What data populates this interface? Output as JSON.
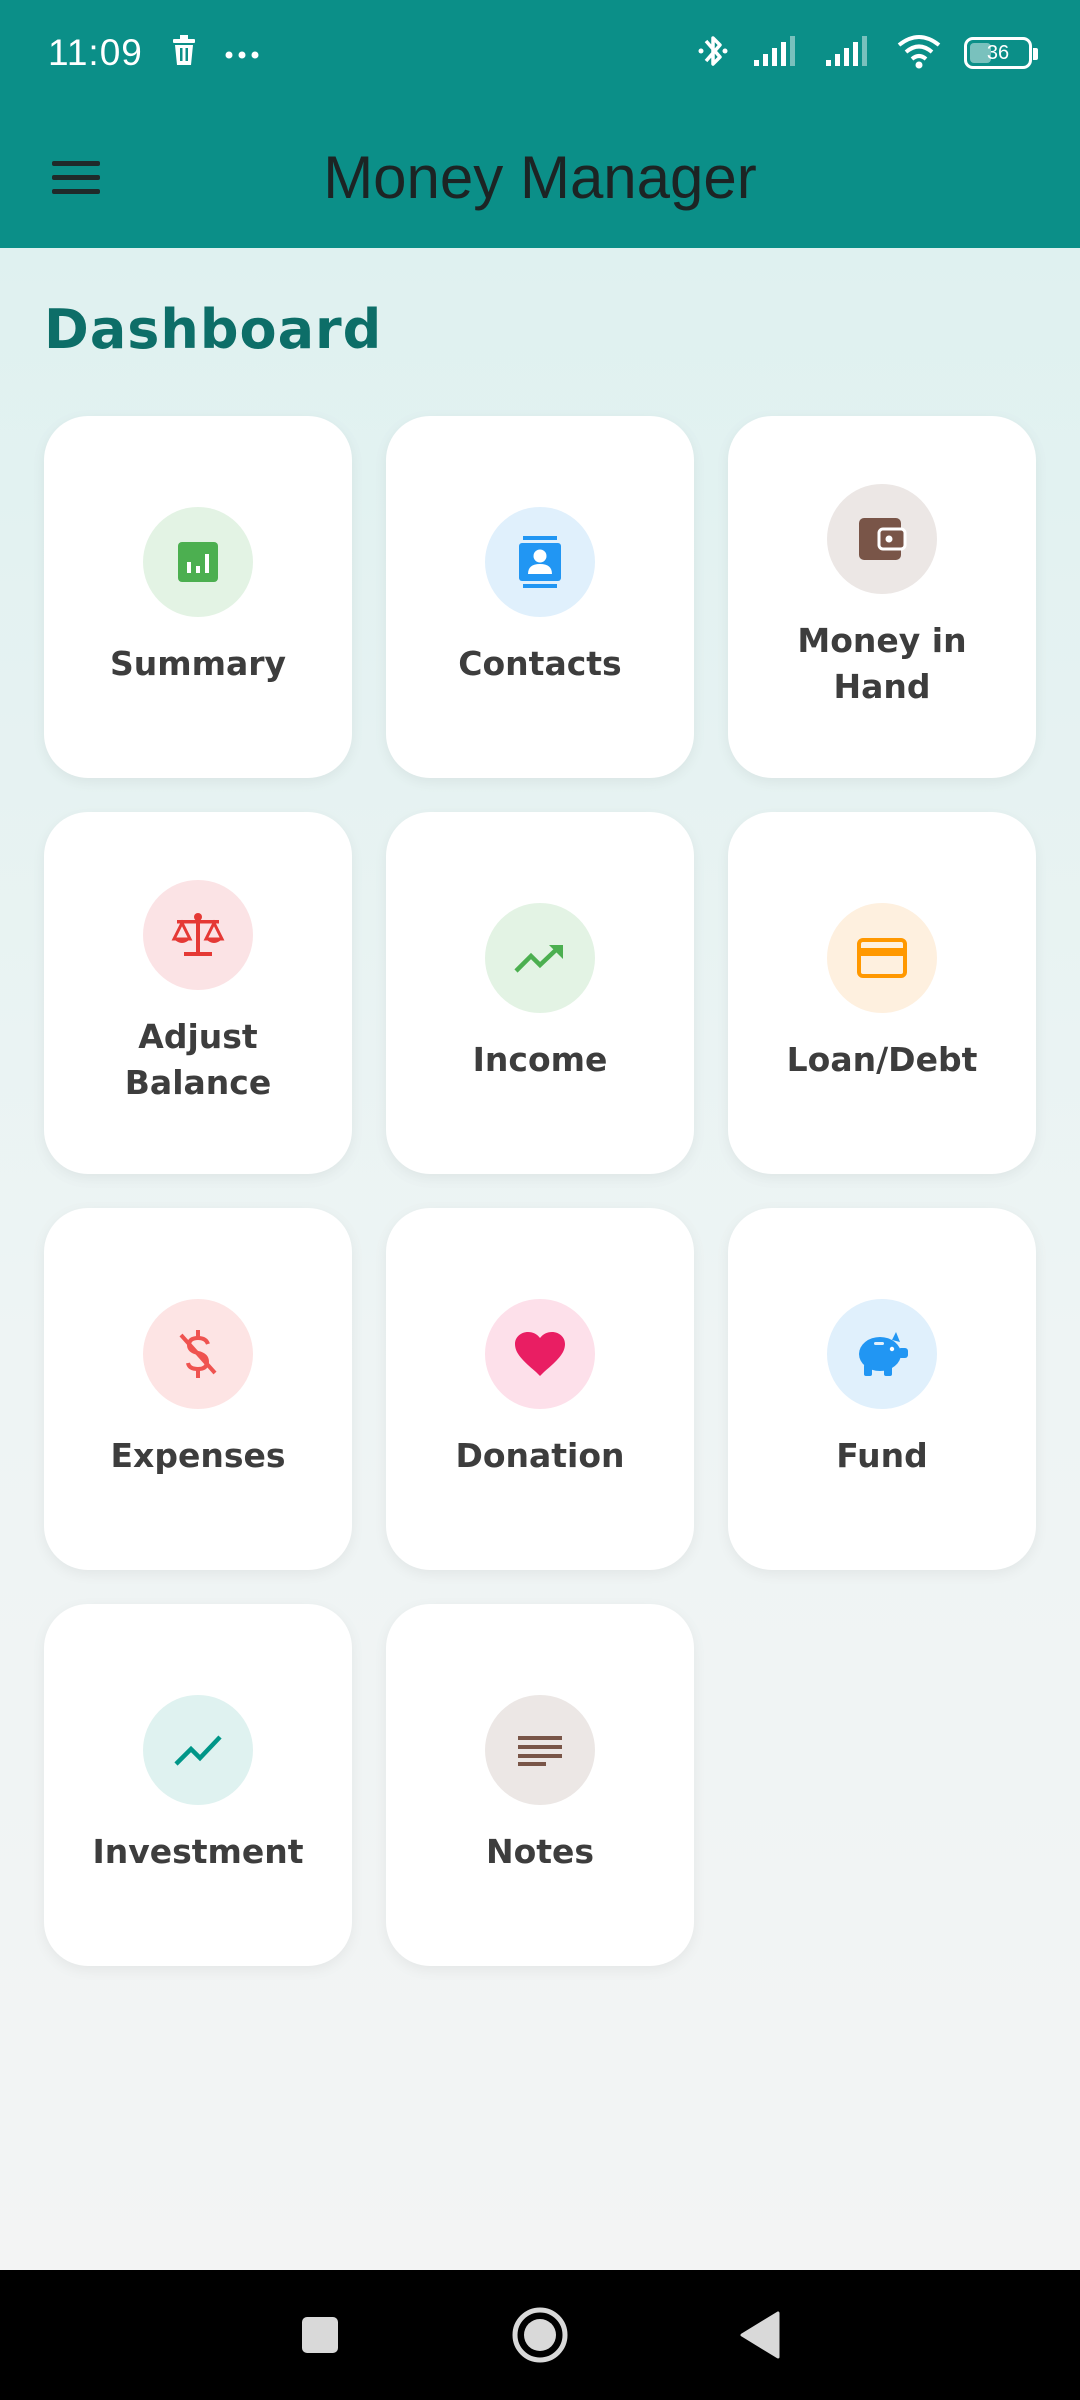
{
  "status_bar": {
    "time": "11:09",
    "battery_level": "36",
    "icons": [
      "delete-icon",
      "more-dots-icon",
      "bluetooth-icon",
      "signal-icon",
      "signal-icon",
      "wifi-icon",
      "battery-icon"
    ]
  },
  "app_bar": {
    "title": "Money Manager",
    "menu_icon": "hamburger-menu-icon"
  },
  "dashboard": {
    "title": "Dashboard",
    "tiles": [
      {
        "label": "Summary",
        "icon": "summary-chart-icon",
        "icon_color": "#4caf50",
        "bg_color": "#e3f3e4"
      },
      {
        "label": "Contacts",
        "icon": "contacts-icon",
        "icon_color": "#2196f3",
        "bg_color": "#e0f0fc"
      },
      {
        "label": "Money in\nHand",
        "icon": "wallet-icon",
        "icon_color": "#795548",
        "bg_color": "#ece7e5"
      },
      {
        "label": "Adjust\nBalance",
        "icon": "balance-scale-icon",
        "icon_color": "#e53935",
        "bg_color": "#fbe3e5"
      },
      {
        "label": "Income",
        "icon": "trending-up-icon",
        "icon_color": "#4caf50",
        "bg_color": "#e3f3e4"
      },
      {
        "label": "Loan/Debt",
        "icon": "credit-card-icon",
        "icon_color": "#ff9800",
        "bg_color": "#fef0df"
      },
      {
        "label": "Expenses",
        "icon": "money-off-icon",
        "icon_color": "#ef5350",
        "bg_color": "#fde4e4"
      },
      {
        "label": "Donation",
        "icon": "heart-icon",
        "icon_color": "#e91e63",
        "bg_color": "#fde0ea"
      },
      {
        "label": "Fund",
        "icon": "piggy-bank-icon",
        "icon_color": "#2196f3",
        "bg_color": "#e0f0fc"
      },
      {
        "label": "Investment",
        "icon": "investment-line-icon",
        "icon_color": "#009688",
        "bg_color": "#dff2f0"
      },
      {
        "label": "Notes",
        "icon": "notes-icon",
        "icon_color": "#795548",
        "bg_color": "#ece7e5"
      }
    ]
  },
  "nav_bar": {
    "icons": [
      "recents-square-icon",
      "home-circle-icon",
      "back-triangle-icon"
    ]
  }
}
